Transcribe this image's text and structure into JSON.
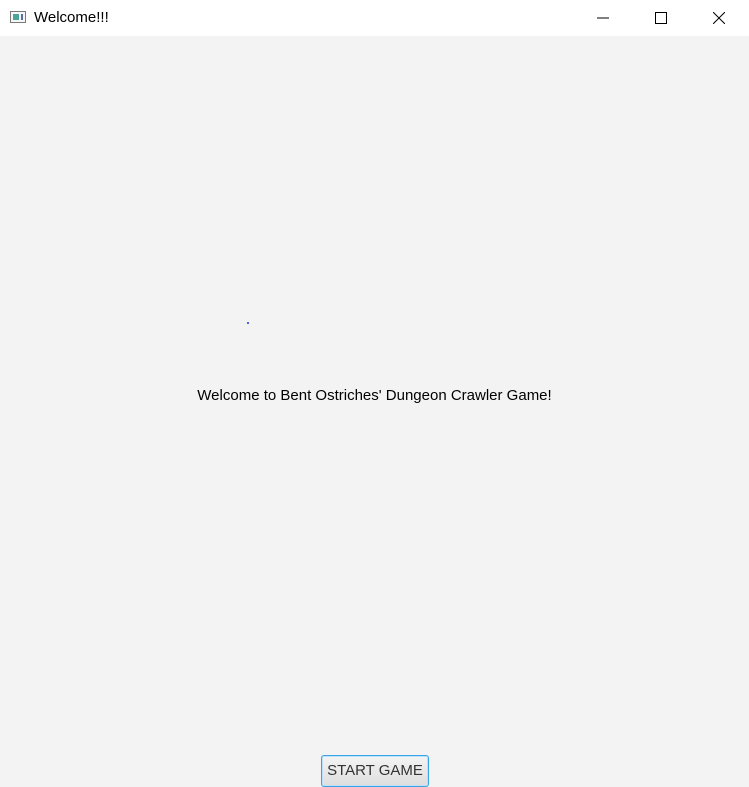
{
  "window": {
    "title": "Welcome!!!",
    "app_icon": "window-icon",
    "controls": {
      "minimize_icon": "minimize-icon",
      "maximize_icon": "maximize-icon",
      "close_icon": "close-icon"
    }
  },
  "main": {
    "welcome_text": "Welcome to Bent Ostriches' Dungeon Crawler Game!",
    "start_button_label": "START GAME"
  },
  "colors": {
    "background": "#f3f3f3",
    "titlebar": "#ffffff",
    "button_focus_border": "#39a4e6"
  }
}
